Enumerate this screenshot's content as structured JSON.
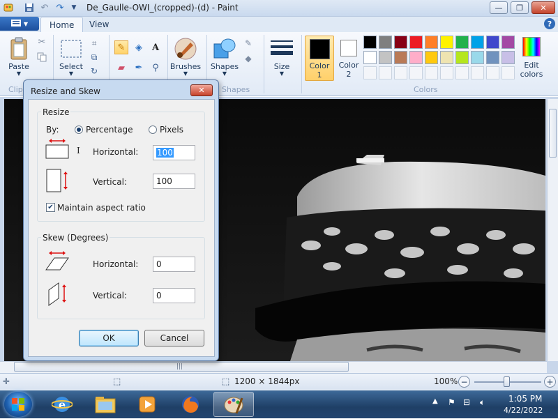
{
  "window": {
    "title": "De_Gaulle-OWI_(cropped)-(d) - Paint",
    "minimize": "—",
    "restore": "❐",
    "close": "✕"
  },
  "ribbon": {
    "tabs": [
      "Home",
      "View"
    ],
    "help": "?",
    "clipboard": {
      "paste": "Paste",
      "group": "Clip"
    },
    "image": {
      "select": "Select"
    },
    "brushes": "Brushes",
    "shapes": {
      "label": "Shapes",
      "group": "Shapes"
    },
    "size": "Size",
    "color1": {
      "line1": "Color",
      "line2": "1"
    },
    "color2": {
      "line1": "Color",
      "line2": "2"
    },
    "edit_colors": {
      "line1": "Edit",
      "line2": "colors"
    },
    "colors_group": "Colors",
    "palette_row1": [
      "#000000",
      "#7f7f7f",
      "#880015",
      "#ed1c24",
      "#ff7f27",
      "#fff200",
      "#22b14c",
      "#00a2e8",
      "#3f48cc",
      "#a349a4"
    ],
    "palette_row2": [
      "#ffffff",
      "#c3c3c3",
      "#b97a57",
      "#ffaec9",
      "#ffc90e",
      "#efe4b0",
      "#b5e61d",
      "#99d9ea",
      "#7092be",
      "#c8bfe7"
    ]
  },
  "dialog": {
    "title": "Resize and Skew",
    "close": "✕",
    "resize": {
      "legend": "Resize",
      "by_label": "By:",
      "percentage": "Percentage",
      "pixels": "Pixels",
      "horizontal_label": "Horizontal:",
      "horizontal_value": "100",
      "vertical_label": "Vertical:",
      "vertical_value": "100",
      "maintain_aspect": "Maintain aspect ratio"
    },
    "skew": {
      "legend": "Skew (Degrees)",
      "horizontal_label": "Horizontal:",
      "horizontal_value": "0",
      "vertical_label": "Vertical:",
      "vertical_value": "0"
    },
    "ok": "OK",
    "cancel": "Cancel"
  },
  "status": {
    "image_size": "1200 × 1844px",
    "zoom": "100%",
    "zoom_out": "−",
    "zoom_in": "+"
  },
  "taskbar": {
    "time": "1:05 PM",
    "date": "4/22/2022"
  }
}
